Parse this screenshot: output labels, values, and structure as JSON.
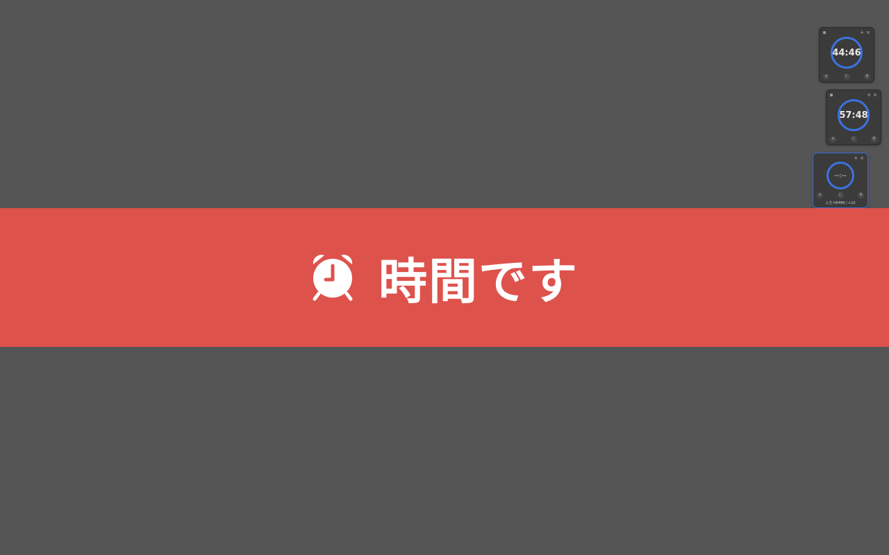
{
  "widgets": [
    {
      "time": "44:46",
      "add_label": "+",
      "close_label": "×",
      "btn_left": "⏸",
      "btn_mid": "☾",
      "btn_right": "⏱",
      "active": false
    },
    {
      "time": "57:48",
      "add_label": "+",
      "close_label": "×",
      "btn_left": "⏸",
      "btn_mid": "☾",
      "btn_right": "⏱",
      "active": false
    },
    {
      "time": "--:--",
      "add_label": "+",
      "close_label": "×",
      "btn_left": "⏸",
      "btn_mid": "☾",
      "btn_right": "⏱",
      "hint": "入力 HHMM / +10",
      "active": true
    }
  ],
  "banner": {
    "icon": "alarm-clock-icon",
    "text": "時間です",
    "background": "#de524c"
  },
  "colors": {
    "desktop": "#555555",
    "widget": "#3b3b3b",
    "ring": "#3d72e0"
  }
}
